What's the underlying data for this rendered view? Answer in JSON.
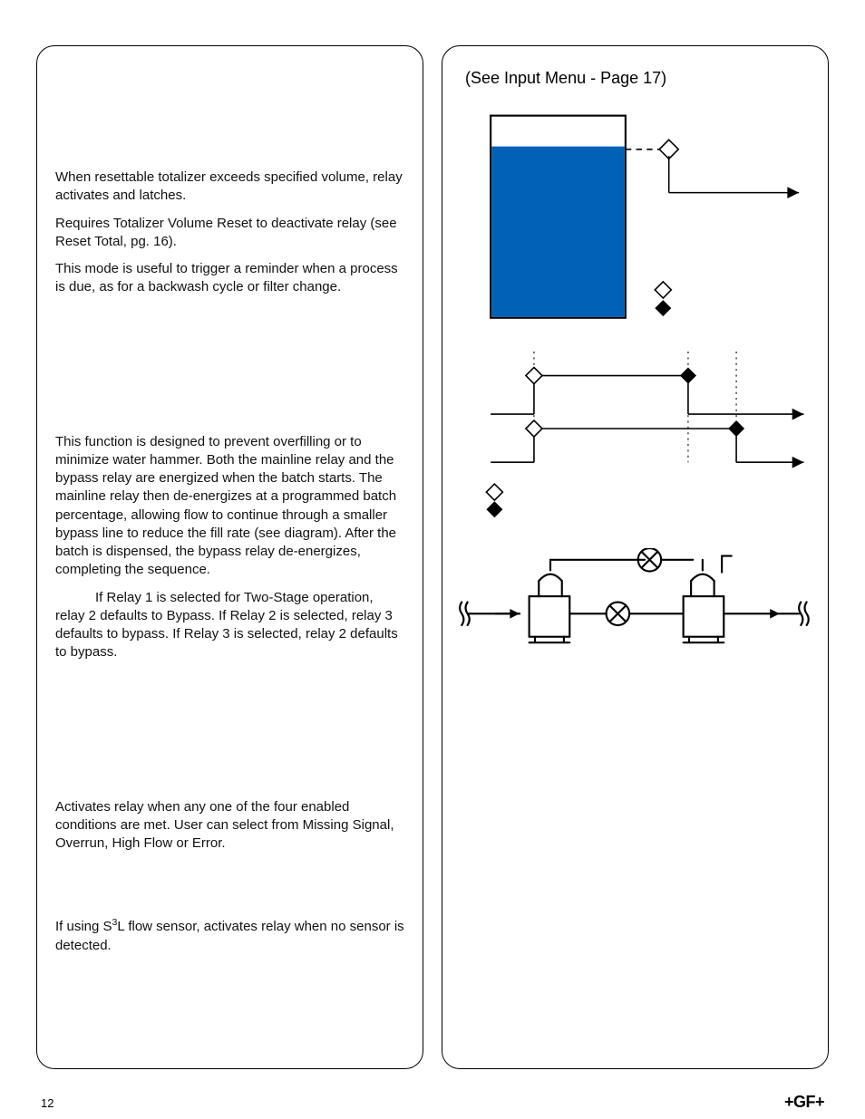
{
  "right": {
    "header": "(See Input Menu - Page 17)"
  },
  "footer": {
    "page_number": "12",
    "brand": "+GF+"
  },
  "colors": {
    "tank_fill": "#0061b6"
  },
  "left": {
    "volume_mode": {
      "p1": "When resettable totalizer exceeds specified volume, relay activates and latches.",
      "p2": "Requires Totalizer Volume Reset to deactivate relay (see Reset Total, pg. 16).",
      "p3": "This mode is useful to trigger a reminder when a process is due, as for a backwash cycle or filter change."
    },
    "two_stage": {
      "p1": "This function is designed to prevent overfilling or to minimize water hammer. Both the mainline relay and the bypass relay are energized when the batch starts. The mainline relay then de-energizes at a programmed batch percentage, allowing flow to continue through a smaller bypass line to reduce the fill rate (see diagram). After the batch is dispensed, the bypass relay de-energizes, completing the sequence.",
      "p2_lead": "",
      "p2": "If Relay 1 is selected for Two-Stage operation, relay 2 defaults to Bypass. If Relay 2 is selected, relay 3 defaults to bypass. If Relay 3 is selected, relay 2 defaults to bypass."
    },
    "multi_alarm": {
      "p1": "Activates relay when any one of the four enabled conditions are met.  User can select from Missing Signal, Overrun, High Flow or Error."
    },
    "missing_signal": {
      "p1_a": "If using S",
      "p1_sup": "3",
      "p1_b": "L flow sensor, activates relay when no sensor is detected."
    }
  },
  "diagrams": {
    "tank_legend": {
      "relay_energized": "relay-energized-icon",
      "relay_deenergized": "relay-deenergized-icon"
    }
  }
}
